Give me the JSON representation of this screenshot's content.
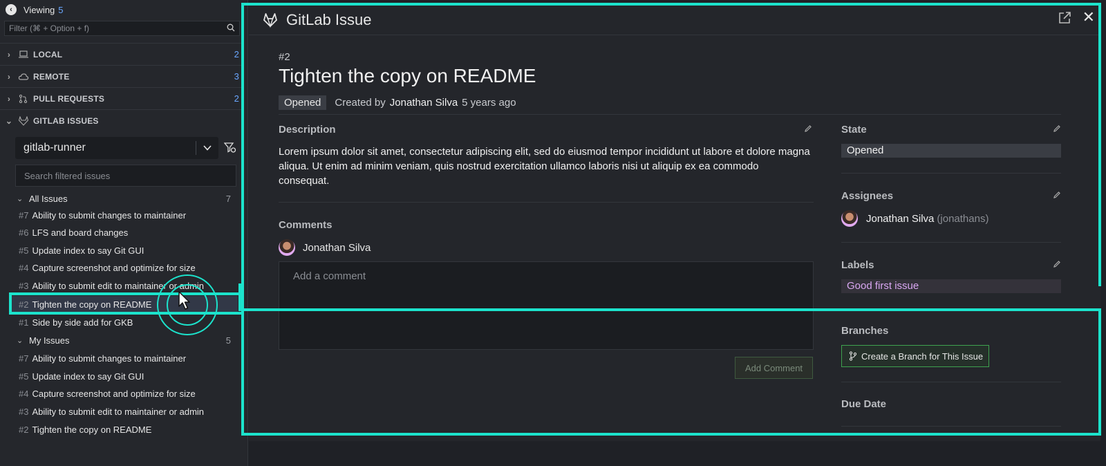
{
  "sidebar": {
    "viewing_label": "Viewing",
    "viewing_count": "5",
    "filter_placeholder": "Filter (⌘ + Option + f)",
    "sections": [
      {
        "label": "LOCAL",
        "count": "2",
        "icon": "laptop-icon"
      },
      {
        "label": "REMOTE",
        "count": "3",
        "icon": "cloud-icon"
      },
      {
        "label": "PULL REQUESTS",
        "count": "2",
        "icon": "pull-request-icon"
      },
      {
        "label": "GITLAB ISSUES",
        "count": "",
        "icon": "gitlab-icon"
      }
    ],
    "repo": "gitlab-runner",
    "search_placeholder": "Search filtered issues",
    "all_issues": {
      "label": "All Issues",
      "count": "7",
      "items": [
        {
          "num": "#7",
          "title": "Ability to submit changes to maintainer"
        },
        {
          "num": "#6",
          "title": "LFS and board changes"
        },
        {
          "num": "#5",
          "title": "Update index to say Git GUI"
        },
        {
          "num": "#4",
          "title": "Capture screenshot and optimize for size"
        },
        {
          "num": "#3",
          "title": "Ability to submit edit to maintainer or admin"
        },
        {
          "num": "#2",
          "title": "Tighten the copy on README"
        },
        {
          "num": "#1",
          "title": "Side by side add for GKB"
        }
      ]
    },
    "my_issues": {
      "label": "My Issues",
      "count": "5",
      "items": [
        {
          "num": "#7",
          "title": "Ability to submit changes to maintainer"
        },
        {
          "num": "#5",
          "title": "Update index to say Git GUI"
        },
        {
          "num": "#4",
          "title": "Capture screenshot and optimize for size"
        },
        {
          "num": "#3",
          "title": "Ability to submit edit to maintainer or admin"
        },
        {
          "num": "#2",
          "title": "Tighten the copy on README"
        }
      ]
    }
  },
  "panel": {
    "title": "GitLab Issue",
    "issue_number": "#2",
    "issue_title": "Tighten the copy on README",
    "status": "Opened",
    "created_by_label": "Created by",
    "author": "Jonathan Silva",
    "age": "5 years ago",
    "description_label": "Description",
    "description": "Lorem ipsum dolor sit amet, consectetur adipiscing elit, sed do eiusmod tempor incididunt ut labore et dolore magna aliqua. Ut enim ad minim veniam, quis nostrud exercitation ullamco laboris nisi ut aliquip ex ea commodo consequat.",
    "comments_label": "Comments",
    "commenter": "Jonathan Silva",
    "comment_placeholder": "Add a comment",
    "add_comment_label": "Add Comment",
    "state_label": "State",
    "state_value": "Opened",
    "assignees_label": "Assignees",
    "assignee_name": "Jonathan Silva",
    "assignee_handle": "(jonathans)",
    "labels_label": "Labels",
    "label_value": "Good first issue",
    "branches_label": "Branches",
    "branch_button": "Create a Branch for This Issue",
    "due_date_label": "Due Date"
  },
  "colors": {
    "highlight": "#1ce3cc",
    "accent_blue": "#6aa7ff",
    "label_purple": "#d9a7f2",
    "branch_green": "#3fa24f"
  }
}
